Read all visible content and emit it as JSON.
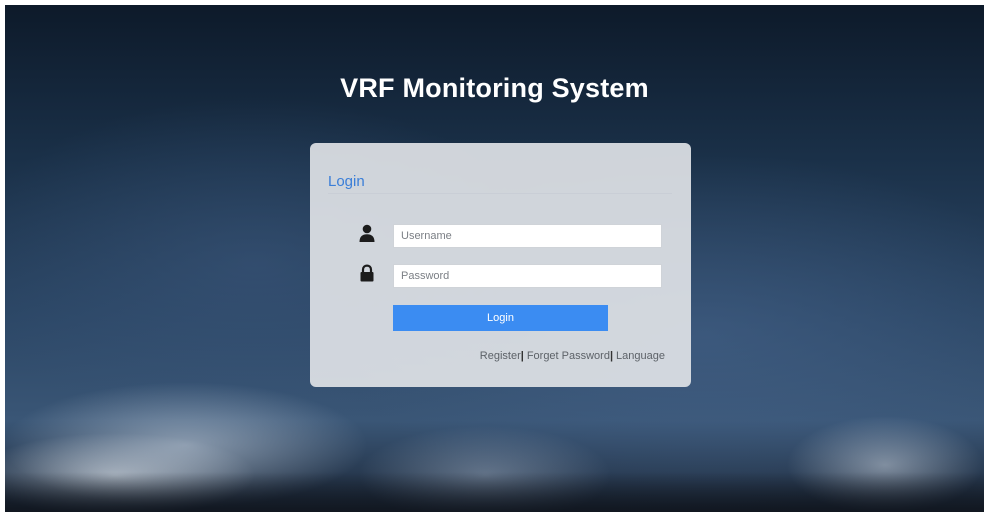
{
  "app": {
    "title": "VRF Monitoring System"
  },
  "login_panel": {
    "heading": "Login",
    "username": {
      "placeholder": "Username",
      "value": "",
      "icon": "user-icon"
    },
    "password": {
      "placeholder": "Password",
      "value": "",
      "icon": "lock-icon"
    },
    "submit_label": "Login",
    "links": [
      {
        "label": "Register"
      },
      {
        "label": "Forget Password"
      },
      {
        "label": "Language"
      }
    ],
    "link_separator": "|"
  },
  "colors": {
    "accent": "#3b8cf2",
    "heading": "#3a7ed8",
    "panel_bg": "#dee1e5",
    "link_text": "#5d6268"
  }
}
